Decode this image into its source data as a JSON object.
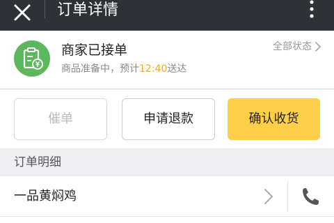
{
  "header": {
    "title": "订单详情"
  },
  "status": {
    "headline": "商家已接单",
    "sub_prefix": "商品准备中，预计",
    "eta": "12:40",
    "sub_suffix": "送达",
    "all_status": "全部状态",
    "badge_icon": "receipt-yuan-icon",
    "badge_color": "#5cb85c",
    "eta_color": "#f5a623"
  },
  "actions": {
    "urge": "催单",
    "refund": "申请退款",
    "confirm": "确认收货",
    "confirm_color": "#ffcf4a"
  },
  "details": {
    "section_title": "订单明细",
    "shop_name": "一品黄焖鸡",
    "icons": [
      "chevron-right-icon",
      "phone-icon"
    ]
  }
}
